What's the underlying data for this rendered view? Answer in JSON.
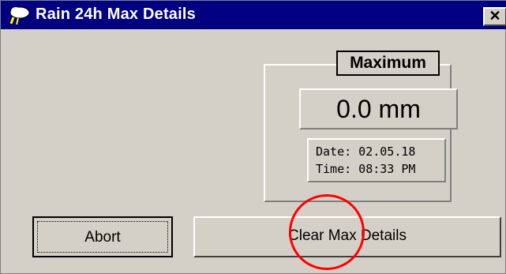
{
  "window": {
    "title": "Rain 24h Max Details",
    "close_symbol": "✕"
  },
  "panel": {
    "heading": "Maximum",
    "value": "0.0 mm",
    "date_line": "Date: 02.05.18",
    "time_line": "Time: 08:33 PM"
  },
  "buttons": {
    "abort": "Abort",
    "clear": "Clear Max Details"
  },
  "colors": {
    "titlebar": "#000080",
    "face": "#d4d0c8",
    "highlight_circle": "#ff0000"
  },
  "icons": {
    "app": "weather-cloud-icon",
    "close": "close-icon"
  }
}
